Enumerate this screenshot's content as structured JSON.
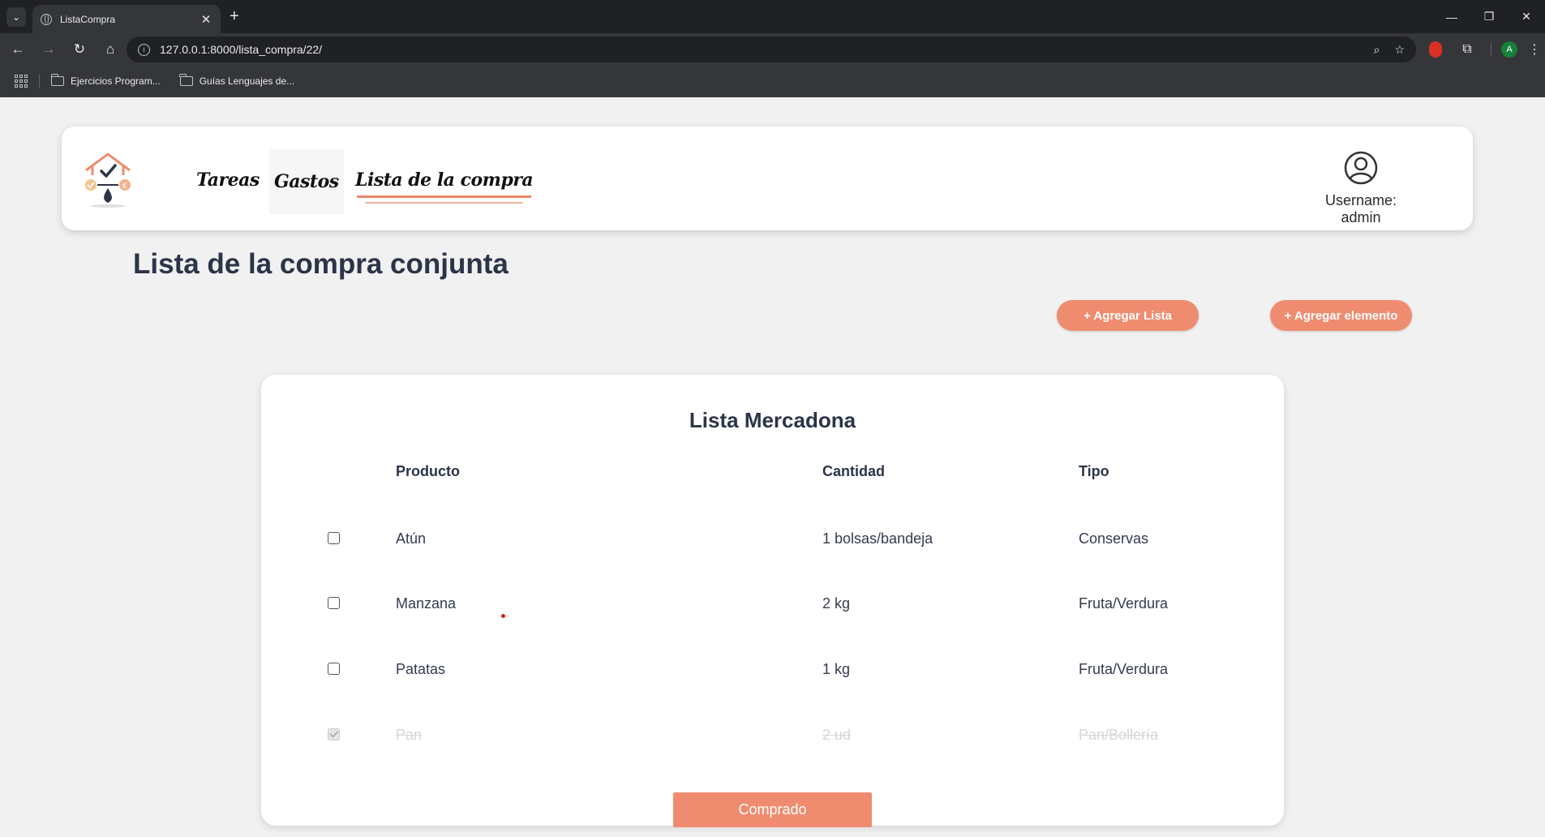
{
  "browser": {
    "tab_title": "ListaCompra",
    "url": "127.0.0.1:8000/lista_compra/22/",
    "bookmarks": [
      "Ejercicios Program...",
      "Guías Lenguajes de..."
    ],
    "avatar_letter": "A"
  },
  "navbar": {
    "links": [
      "Tareas",
      "Gastos",
      "Lista de la compra"
    ],
    "active_link": "Lista de la compra",
    "username_label": "Username: admin"
  },
  "page": {
    "title": "Lista de la compra conjunta",
    "add_list_button": "+ Agregar Lista",
    "add_item_button": "+ Agregar elemento"
  },
  "list": {
    "name": "Lista Mercadona",
    "headers": {
      "product": "Producto",
      "quantity": "Cantidad",
      "type": "Tipo"
    },
    "items": [
      {
        "product": "Atún",
        "quantity": "1 bolsas/bandeja",
        "type": "Conservas",
        "checked": false
      },
      {
        "product": "Manzana",
        "quantity": "2 kg",
        "type": "Fruta/Verdura",
        "checked": false
      },
      {
        "product": "Patatas",
        "quantity": "1 kg",
        "type": "Fruta/Verdura",
        "checked": false
      },
      {
        "product": "Pan",
        "quantity": "2 ud",
        "type": "Pan/Bollería",
        "checked": true
      }
    ],
    "bought_button": "Comprado"
  },
  "colors": {
    "accent": "#ef8c70",
    "title": "#2b3448"
  }
}
